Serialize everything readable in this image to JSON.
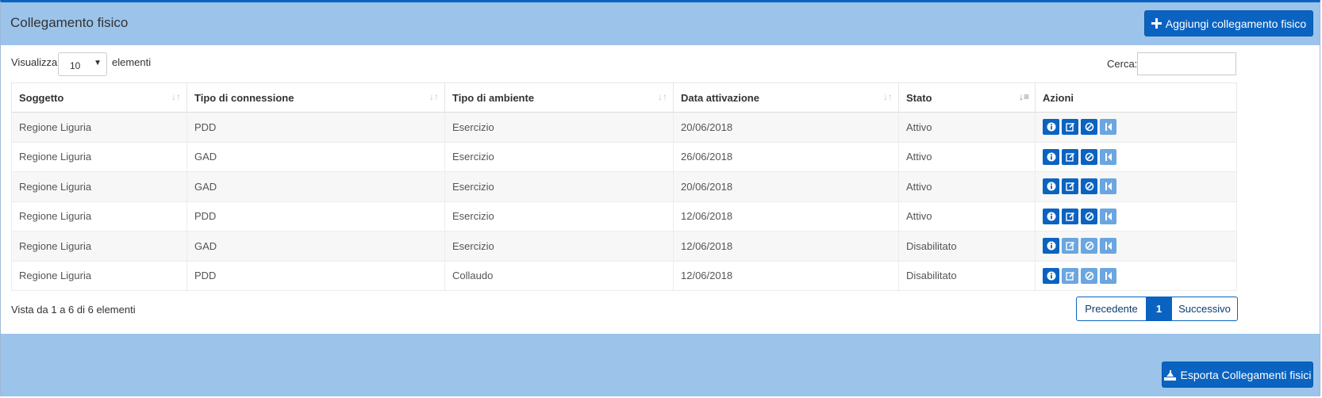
{
  "header": {
    "title": "Collegamento fisico",
    "add_button": "Aggiungi collegamento fisico"
  },
  "length": {
    "prefix": "Visualizza",
    "value": "10",
    "suffix": "elementi"
  },
  "search": {
    "label": "Cerca:",
    "value": ""
  },
  "table": {
    "columns": [
      "Soggetto",
      "Tipo di connessione",
      "Tipo di ambiente",
      "Data attivazione",
      "Stato",
      "Azioni"
    ],
    "rows": [
      {
        "soggetto": "Regione Liguria",
        "connessione": "PDD",
        "ambiente": "Esercizio",
        "data": "20/06/2018",
        "stato": "Attivo"
      },
      {
        "soggetto": "Regione Liguria",
        "connessione": "GAD",
        "ambiente": "Esercizio",
        "data": "26/06/2018",
        "stato": "Attivo"
      },
      {
        "soggetto": "Regione Liguria",
        "connessione": "GAD",
        "ambiente": "Esercizio",
        "data": "20/06/2018",
        "stato": "Attivo"
      },
      {
        "soggetto": "Regione Liguria",
        "connessione": "PDD",
        "ambiente": "Esercizio",
        "data": "12/06/2018",
        "stato": "Attivo"
      },
      {
        "soggetto": "Regione Liguria",
        "connessione": "GAD",
        "ambiente": "Esercizio",
        "data": "12/06/2018",
        "stato": "Disabilitato"
      },
      {
        "soggetto": "Regione Liguria",
        "connessione": "PDD",
        "ambiente": "Collaudo",
        "data": "12/06/2018",
        "stato": "Disabilitato"
      }
    ]
  },
  "info": "Vista da 1 a 6 di 6 elementi",
  "pagination": {
    "prev": "Precedente",
    "current": "1",
    "next": "Successivo"
  },
  "footer": {
    "export_button": "Esporta Collegamenti fisici"
  },
  "colors": {
    "primary": "#0b63c1",
    "header_bg": "#9cc3ea",
    "disabled_action": "#6aa6e0"
  }
}
